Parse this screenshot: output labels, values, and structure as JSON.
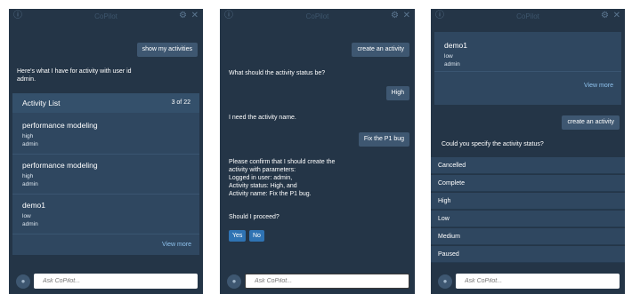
{
  "header": {
    "title": "CoPilot",
    "help_icon": "help-circle-icon",
    "settings_icon": "gear-icon",
    "close_icon": "close-icon"
  },
  "input": {
    "placeholder": "Ask CoPilot..."
  },
  "panel1": {
    "user_message": "show my activities",
    "bot_message_line1": "Here's what I have for activity with user id",
    "bot_message_line2": "admin.",
    "card": {
      "title": "Activity List",
      "count": "3 of 22",
      "items": [
        {
          "name": "performance modeling",
          "priority": "high",
          "owner": "admin"
        },
        {
          "name": "performance modeling",
          "priority": "high",
          "owner": "admin"
        },
        {
          "name": "demo1",
          "priority": "low",
          "owner": "admin"
        }
      ],
      "view_more": "View more"
    }
  },
  "panel2": {
    "user_message_1": "create an activity",
    "bot_message_1": "What should the activity status be?",
    "user_message_2": "High",
    "bot_message_2": "I need the activity name.",
    "user_message_3": "Fix the P1 bug",
    "confirm_lines": [
      "Please confirm that I should create the",
      "activity with parameters:",
      "Logged in user: admin,",
      "Activity status: High, and",
      "Activity name: Fix the P1 bug."
    ],
    "proceed": "Should I proceed?",
    "yes_label": "Yes",
    "no_label": "No"
  },
  "panel3": {
    "card_item": {
      "name": "demo1",
      "priority": "low",
      "owner": "admin"
    },
    "view_more": "View more",
    "user_message": "create an activity",
    "bot_message": "Could you specify the activity status?",
    "options": [
      "Cancelled",
      "Complete",
      "High",
      "Low",
      "Medium",
      "Paused"
    ]
  },
  "colors": {
    "panel_bg": "#243547",
    "card_bg": "#2f4760",
    "user_bubble": "#3e5771",
    "link": "#8fc3ee",
    "button": "#2f73b3"
  }
}
